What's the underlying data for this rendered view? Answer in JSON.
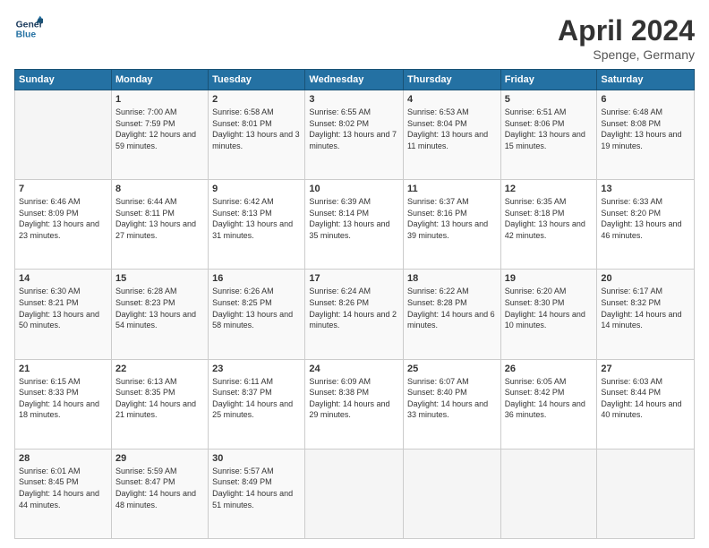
{
  "header": {
    "logo_line1": "General",
    "logo_line2": "Blue",
    "month_title": "April 2024",
    "location": "Spenge, Germany"
  },
  "weekdays": [
    "Sunday",
    "Monday",
    "Tuesday",
    "Wednesday",
    "Thursday",
    "Friday",
    "Saturday"
  ],
  "weeks": [
    [
      {
        "day": "",
        "sunrise": "",
        "sunset": "",
        "daylight": ""
      },
      {
        "day": "1",
        "sunrise": "Sunrise: 7:00 AM",
        "sunset": "Sunset: 7:59 PM",
        "daylight": "Daylight: 12 hours and 59 minutes."
      },
      {
        "day": "2",
        "sunrise": "Sunrise: 6:58 AM",
        "sunset": "Sunset: 8:01 PM",
        "daylight": "Daylight: 13 hours and 3 minutes."
      },
      {
        "day": "3",
        "sunrise": "Sunrise: 6:55 AM",
        "sunset": "Sunset: 8:02 PM",
        "daylight": "Daylight: 13 hours and 7 minutes."
      },
      {
        "day": "4",
        "sunrise": "Sunrise: 6:53 AM",
        "sunset": "Sunset: 8:04 PM",
        "daylight": "Daylight: 13 hours and 11 minutes."
      },
      {
        "day": "5",
        "sunrise": "Sunrise: 6:51 AM",
        "sunset": "Sunset: 8:06 PM",
        "daylight": "Daylight: 13 hours and 15 minutes."
      },
      {
        "day": "6",
        "sunrise": "Sunrise: 6:48 AM",
        "sunset": "Sunset: 8:08 PM",
        "daylight": "Daylight: 13 hours and 19 minutes."
      }
    ],
    [
      {
        "day": "7",
        "sunrise": "Sunrise: 6:46 AM",
        "sunset": "Sunset: 8:09 PM",
        "daylight": "Daylight: 13 hours and 23 minutes."
      },
      {
        "day": "8",
        "sunrise": "Sunrise: 6:44 AM",
        "sunset": "Sunset: 8:11 PM",
        "daylight": "Daylight: 13 hours and 27 minutes."
      },
      {
        "day": "9",
        "sunrise": "Sunrise: 6:42 AM",
        "sunset": "Sunset: 8:13 PM",
        "daylight": "Daylight: 13 hours and 31 minutes."
      },
      {
        "day": "10",
        "sunrise": "Sunrise: 6:39 AM",
        "sunset": "Sunset: 8:14 PM",
        "daylight": "Daylight: 13 hours and 35 minutes."
      },
      {
        "day": "11",
        "sunrise": "Sunrise: 6:37 AM",
        "sunset": "Sunset: 8:16 PM",
        "daylight": "Daylight: 13 hours and 39 minutes."
      },
      {
        "day": "12",
        "sunrise": "Sunrise: 6:35 AM",
        "sunset": "Sunset: 8:18 PM",
        "daylight": "Daylight: 13 hours and 42 minutes."
      },
      {
        "day": "13",
        "sunrise": "Sunrise: 6:33 AM",
        "sunset": "Sunset: 8:20 PM",
        "daylight": "Daylight: 13 hours and 46 minutes."
      }
    ],
    [
      {
        "day": "14",
        "sunrise": "Sunrise: 6:30 AM",
        "sunset": "Sunset: 8:21 PM",
        "daylight": "Daylight: 13 hours and 50 minutes."
      },
      {
        "day": "15",
        "sunrise": "Sunrise: 6:28 AM",
        "sunset": "Sunset: 8:23 PM",
        "daylight": "Daylight: 13 hours and 54 minutes."
      },
      {
        "day": "16",
        "sunrise": "Sunrise: 6:26 AM",
        "sunset": "Sunset: 8:25 PM",
        "daylight": "Daylight: 13 hours and 58 minutes."
      },
      {
        "day": "17",
        "sunrise": "Sunrise: 6:24 AM",
        "sunset": "Sunset: 8:26 PM",
        "daylight": "Daylight: 14 hours and 2 minutes."
      },
      {
        "day": "18",
        "sunrise": "Sunrise: 6:22 AM",
        "sunset": "Sunset: 8:28 PM",
        "daylight": "Daylight: 14 hours and 6 minutes."
      },
      {
        "day": "19",
        "sunrise": "Sunrise: 6:20 AM",
        "sunset": "Sunset: 8:30 PM",
        "daylight": "Daylight: 14 hours and 10 minutes."
      },
      {
        "day": "20",
        "sunrise": "Sunrise: 6:17 AM",
        "sunset": "Sunset: 8:32 PM",
        "daylight": "Daylight: 14 hours and 14 minutes."
      }
    ],
    [
      {
        "day": "21",
        "sunrise": "Sunrise: 6:15 AM",
        "sunset": "Sunset: 8:33 PM",
        "daylight": "Daylight: 14 hours and 18 minutes."
      },
      {
        "day": "22",
        "sunrise": "Sunrise: 6:13 AM",
        "sunset": "Sunset: 8:35 PM",
        "daylight": "Daylight: 14 hours and 21 minutes."
      },
      {
        "day": "23",
        "sunrise": "Sunrise: 6:11 AM",
        "sunset": "Sunset: 8:37 PM",
        "daylight": "Daylight: 14 hours and 25 minutes."
      },
      {
        "day": "24",
        "sunrise": "Sunrise: 6:09 AM",
        "sunset": "Sunset: 8:38 PM",
        "daylight": "Daylight: 14 hours and 29 minutes."
      },
      {
        "day": "25",
        "sunrise": "Sunrise: 6:07 AM",
        "sunset": "Sunset: 8:40 PM",
        "daylight": "Daylight: 14 hours and 33 minutes."
      },
      {
        "day": "26",
        "sunrise": "Sunrise: 6:05 AM",
        "sunset": "Sunset: 8:42 PM",
        "daylight": "Daylight: 14 hours and 36 minutes."
      },
      {
        "day": "27",
        "sunrise": "Sunrise: 6:03 AM",
        "sunset": "Sunset: 8:44 PM",
        "daylight": "Daylight: 14 hours and 40 minutes."
      }
    ],
    [
      {
        "day": "28",
        "sunrise": "Sunrise: 6:01 AM",
        "sunset": "Sunset: 8:45 PM",
        "daylight": "Daylight: 14 hours and 44 minutes."
      },
      {
        "day": "29",
        "sunrise": "Sunrise: 5:59 AM",
        "sunset": "Sunset: 8:47 PM",
        "daylight": "Daylight: 14 hours and 48 minutes."
      },
      {
        "day": "30",
        "sunrise": "Sunrise: 5:57 AM",
        "sunset": "Sunset: 8:49 PM",
        "daylight": "Daylight: 14 hours and 51 minutes."
      },
      {
        "day": "",
        "sunrise": "",
        "sunset": "",
        "daylight": ""
      },
      {
        "day": "",
        "sunrise": "",
        "sunset": "",
        "daylight": ""
      },
      {
        "day": "",
        "sunrise": "",
        "sunset": "",
        "daylight": ""
      },
      {
        "day": "",
        "sunrise": "",
        "sunset": "",
        "daylight": ""
      }
    ]
  ]
}
